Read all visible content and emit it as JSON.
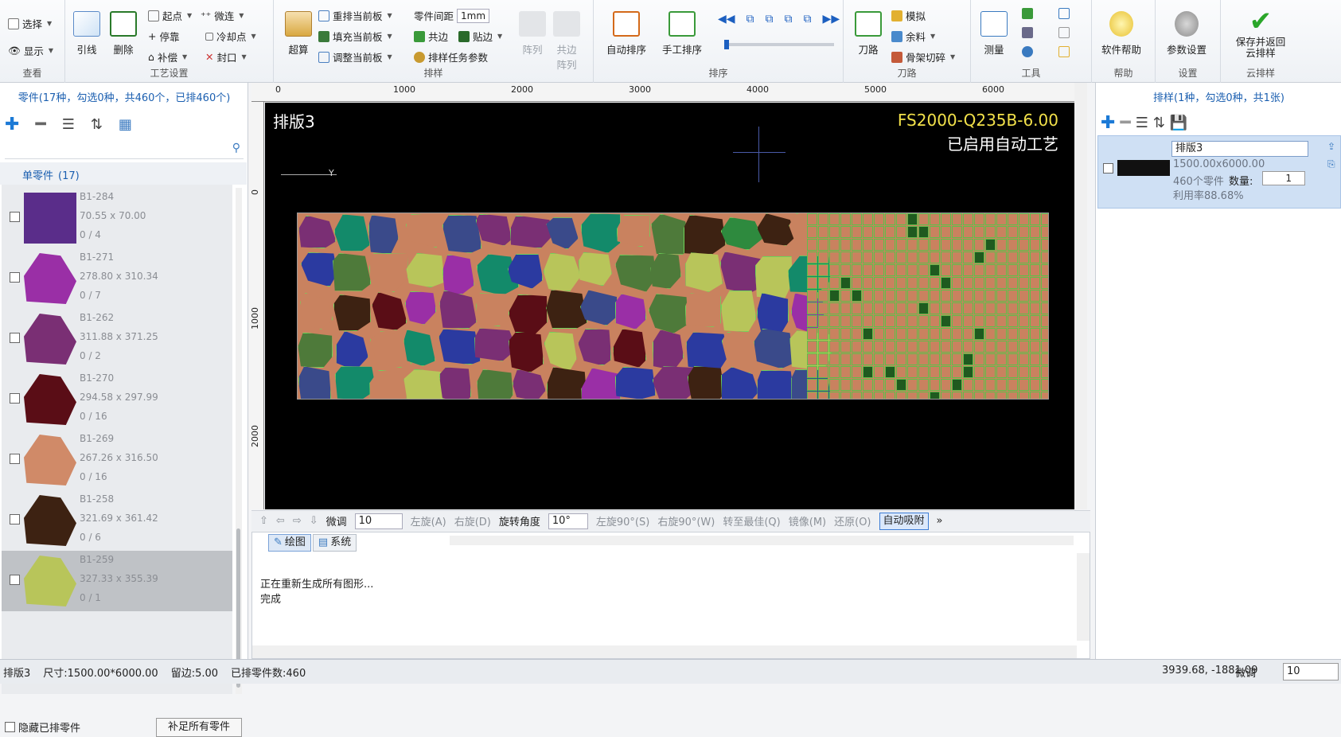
{
  "ribbon": {
    "view": {
      "select": "选择",
      "display": "显示",
      "title": "查看"
    },
    "process": {
      "lead": "引线",
      "delete": "删除",
      "start_point": "起点",
      "micro_joint": "微连",
      "stop_point": "停靠",
      "cooling_point": "冷却点",
      "compensation": "补偿",
      "seal": "封口",
      "title": "工艺设置"
    },
    "nesting": {
      "super_calc": "超算",
      "renest": "重排当前板",
      "fill": "填充当前板",
      "adjust": "调整当前板",
      "part_gap_label": "零件间距",
      "part_gap_value": "1mm",
      "common_edge": "共边",
      "attach_edge": "贴边",
      "task_params": "排样任务参数",
      "array": "阵列",
      "common_array": "共边阵列",
      "title": "排样"
    },
    "sort": {
      "auto": "自动排序",
      "manual": "手工排序",
      "title": "排序"
    },
    "toolpath": {
      "toolpath": "刀路",
      "simulate": "模拟",
      "remnant": "余料",
      "skeleton_cut": "骨架切碎",
      "title": "刀路"
    },
    "tools": {
      "measure": "测量",
      "title": "工具"
    },
    "help": {
      "help": "软件帮助",
      "title": "帮助"
    },
    "settings": {
      "params": "参数设置",
      "title": "设置"
    },
    "cloud": {
      "save": "保存并返回云排样",
      "title": "云排样"
    }
  },
  "left": {
    "title": "零件(17种，勾选0种，共460个，已排460个)",
    "section_label": "单零件",
    "section_count": "(17)",
    "parts": [
      {
        "name": "B1-284",
        "size": "70.55 x 70.00",
        "qty": "0 / 4",
        "color": "#5a2d8a"
      },
      {
        "name": "B1-271",
        "size": "278.80 x 310.34",
        "qty": "0 / 7",
        "color": "#9a2fa6"
      },
      {
        "name": "B1-262",
        "size": "311.88 x 371.25",
        "qty": "0 / 2",
        "color": "#7a2f74"
      },
      {
        "name": "B1-270",
        "size": "294.58 x 297.99",
        "qty": "0 / 16",
        "color": "#5a0d16"
      },
      {
        "name": "B1-269",
        "size": "267.26 x 316.50",
        "qty": "0 / 16",
        "color": "#d08a68"
      },
      {
        "name": "B1-258",
        "size": "321.69 x 361.42",
        "qty": "0 / 6",
        "color": "#3d2212"
      },
      {
        "name": "B1-259",
        "size": "327.33 x 355.39",
        "qty": "0 / 1",
        "color": "#b8c55a"
      }
    ],
    "hide_nested": "隐藏已排零件",
    "fill_all": "补足所有零件"
  },
  "canvas": {
    "sheet_label": "排版3",
    "material": "FS2000-Q235B-6.00",
    "auto_craft": "已启用自动工艺",
    "ruler_x": [
      "0",
      "1000",
      "2000",
      "3000",
      "4000",
      "5000",
      "6000"
    ],
    "ruler_y": [
      "0",
      "1000",
      "2000"
    ]
  },
  "canvas_toolbar": {
    "fine_label": "微调",
    "fine_value": "10",
    "rotate_left": "左旋(A)",
    "rotate_right": "右旋(D)",
    "angle_label": "旋转角度",
    "angle_value": "10°",
    "left90": "左旋90°(S)",
    "right90": "右旋90°(W)",
    "best": "转至最佳(Q)",
    "mirror": "镜像(M)",
    "restore": "还原(O)",
    "auto_snap": "自动吸附"
  },
  "log": {
    "tab_draw": "绘图",
    "tab_system": "系统",
    "lines": [
      "正在重新生成所有图形...",
      "完成"
    ]
  },
  "right": {
    "title": "排样(1种，勾选0种，共1张)",
    "sheet_name": "排版3",
    "dims": "1500.00x6000.00",
    "count": "460个零件",
    "qty_label": "数量:",
    "qty_value": "1",
    "utilization": "利用率88.68%"
  },
  "status": {
    "sheet": "排版3",
    "size": "尺寸:1500.00*6000.00",
    "margin": "留边:5.00",
    "nested": "已排零件数:460",
    "coords": "3939.68, -1881.09",
    "fine_label": "微调",
    "fine_value": "10"
  }
}
